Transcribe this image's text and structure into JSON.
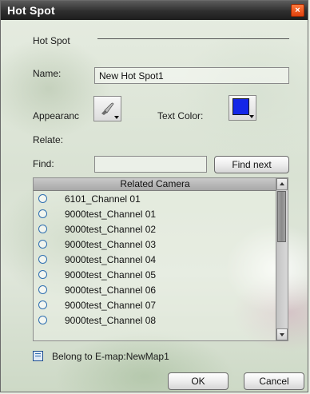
{
  "window": {
    "title": "Hot Spot",
    "close_glyph": "×"
  },
  "form": {
    "hotspot_section_label": "Hot Spot",
    "name_label": "Name:",
    "name_value": "New Hot Spot1",
    "appearance_label": "Appearanc",
    "text_color_label": "Text Color:",
    "text_color_value": "#1426e8",
    "relate_label": "Relate:",
    "find_label": "Find:",
    "find_value": "",
    "find_next_label": "Find next"
  },
  "list": {
    "header": "Related Camera",
    "items": [
      "6101_Channel 01",
      "9000test_Channel 01",
      "9000test_Channel 02",
      "9000test_Channel 03",
      "9000test_Channel 04",
      "9000test_Channel 05",
      "9000test_Channel 06",
      "9000test_Channel 07",
      "9000test_Channel 08"
    ]
  },
  "footer": {
    "belong_text": "Belong to E-map:NewMap1",
    "ok_label": "OK",
    "cancel_label": "Cancel"
  },
  "icons": {
    "appearance": "paint-brush-icon",
    "belong": "map-list-icon"
  }
}
